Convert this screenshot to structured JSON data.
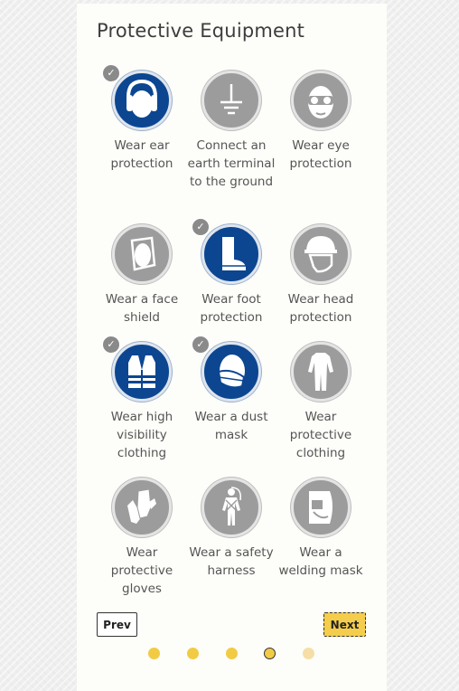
{
  "title": "Protective Equipment",
  "colors": {
    "selected_icon_bg": "#0c4691",
    "unselected_icon_bg": "#9c9c9c",
    "accent": "#f4cd4c"
  },
  "items": [
    {
      "label": "Wear ear protection",
      "icon": "ear-protection-icon",
      "selected": true
    },
    {
      "label": "Connect an earth terminal to the ground",
      "icon": "earth-terminal-icon",
      "selected": false
    },
    {
      "label": "Wear eye protection",
      "icon": "eye-protection-icon",
      "selected": false
    },
    {
      "label": "Wear a face shield",
      "icon": "face-shield-icon",
      "selected": false
    },
    {
      "label": "Wear foot protection",
      "icon": "foot-protection-icon",
      "selected": true
    },
    {
      "label": "Wear head protection",
      "icon": "head-protection-icon",
      "selected": false
    },
    {
      "label": "Wear high visibility clothing",
      "icon": "high-visibility-vest-icon",
      "selected": true
    },
    {
      "label": "Wear a dust mask",
      "icon": "dust-mask-icon",
      "selected": true
    },
    {
      "label": "Wear protective clothing",
      "icon": "protective-coverall-icon",
      "selected": false
    },
    {
      "label": "Wear protective gloves",
      "icon": "gloves-icon",
      "selected": false
    },
    {
      "label": "Wear a safety harness",
      "icon": "safety-harness-icon",
      "selected": false
    },
    {
      "label": "Wear a welding mask",
      "icon": "welding-mask-icon",
      "selected": false
    }
  ],
  "check_glyph": "✓",
  "nav": {
    "prev_label": "Prev",
    "next_label": "Next"
  },
  "pagination": {
    "total_pages": 5,
    "current_page": 4
  }
}
